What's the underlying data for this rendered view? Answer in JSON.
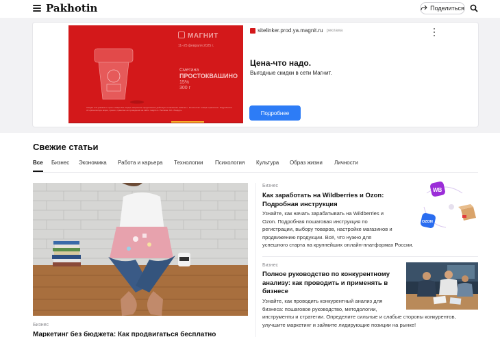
{
  "header": {
    "logo": "Pakhotin",
    "share_label": "Поделиться"
  },
  "ad": {
    "domain": "sitelinker.prod.ya.magnit.ru",
    "tag": "реклама",
    "title": "Цена-что надо.",
    "subtitle": "Выгодные скидки в сети Магнит.",
    "cta": "Подробнее",
    "image": {
      "brand": "МАГНИТ",
      "date": "11–25 февраля 2025 г.",
      "product_line1": "Сметана",
      "product_line2": "ПРОСТОКВАШИНО",
      "product_line3": "15%",
      "product_line4": "300 г",
      "fine_print": "Скидка в % указана от цены товара без скидки. Акционное предложение действует в магазинах «Магнит». Количество товара ограничено. Подробности об организаторе акции, сроках, правилах её проведения на сайте magnit.ru. Реклама. АО «Тандер»."
    }
  },
  "section": {
    "title": "Свежие статьи",
    "tabs": [
      "Все",
      "Бизнес",
      "Экономика",
      "Работа и карьера",
      "Технологии",
      "Психология",
      "Культура",
      "Образ жизни",
      "Личности"
    ]
  },
  "big_article": {
    "category": "Бизнес",
    "title": "Маркетинг без бюджета: Как продвигаться бесплатно"
  },
  "articles": [
    {
      "category": "Бизнес",
      "title_lines": [
        "Как заработать на Wildberries и Ozon:",
        "Подробная инструкция"
      ],
      "desc_lines": [
        "Узнайте, как начать зарабатывать на Wildberries и",
        "Ozon. Подробная пошаговая инструкция по",
        "регистрации, выбору товаров, настройке магазинов и",
        "продвижению продукции. Всё, что нужно для",
        "успешного старта на крупнейших онлайн-платформах России."
      ],
      "thumb_labels": [
        "WB",
        "OZON"
      ]
    },
    {
      "category": "Бизнес",
      "title_lines": [
        "Полное руководство по конкурентному",
        "анализу: как проводить и применять в",
        "бизнесе"
      ],
      "desc_lines": [
        "Узнайте, как проводить конкурентный анализ для",
        "бизнеса: пошаговое руководство, методологии,",
        "инструменты и стратегии. Определите сильные и слабые стороны конкурентов,",
        "улучшите маркетинг и займите лидирующие позиции на рынке!"
      ]
    }
  ],
  "colors": {
    "ad_red": "#d3181a",
    "cta_blue": "#2d7cf6",
    "wb_purple": "#9b2dd8",
    "ozon_blue": "#2a6df0"
  }
}
